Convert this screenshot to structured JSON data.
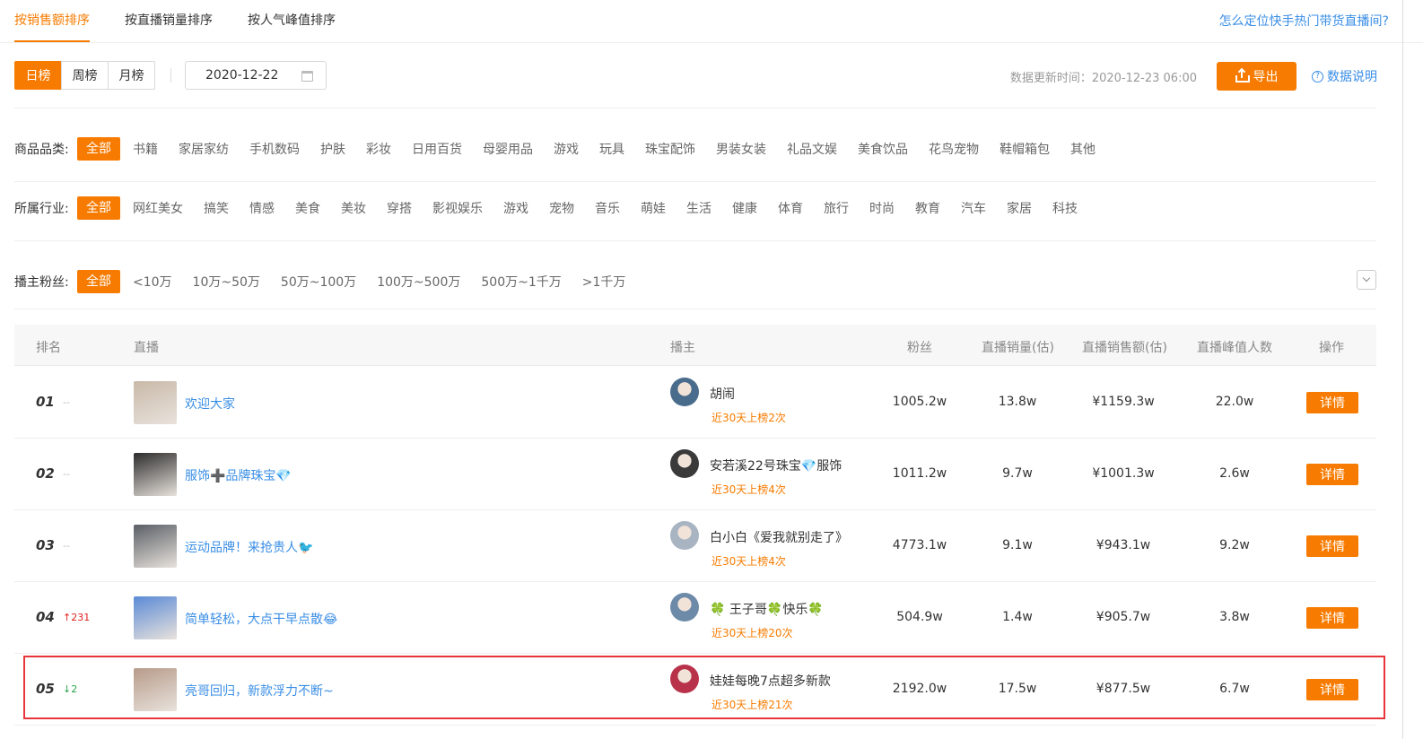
{
  "tabs": [
    {
      "label": "按销售额排序",
      "active": true
    },
    {
      "label": "按直播销量排序",
      "active": false
    },
    {
      "label": "按人气峰值排序",
      "active": false
    }
  ],
  "help_link": "怎么定位快手热门带货直播间?",
  "periods": [
    {
      "label": "日榜",
      "active": true
    },
    {
      "label": "周榜",
      "active": false
    },
    {
      "label": "月榜",
      "active": false
    }
  ],
  "date_value": "2020-12-22",
  "update_time": "数据更新时间：2020-12-23 06:00",
  "export_label": "导出",
  "data_desc_label": "数据说明",
  "filters": {
    "category": {
      "label": "商品品类:",
      "options": [
        "全部",
        "书籍",
        "家居家纺",
        "手机数码",
        "护肤",
        "彩妆",
        "日用百货",
        "母婴用品",
        "游戏",
        "玩具",
        "珠宝配饰",
        "男装女装",
        "礼品文娱",
        "美食饮品",
        "花鸟宠物",
        "鞋帽箱包",
        "其他"
      ]
    },
    "industry": {
      "label": "所属行业:",
      "options": [
        "全部",
        "网红美女",
        "搞笑",
        "情感",
        "美食",
        "美妆",
        "穿搭",
        "影视娱乐",
        "游戏",
        "宠物",
        "音乐",
        "萌娃",
        "生活",
        "健康",
        "体育",
        "旅行",
        "时尚",
        "教育",
        "汽车",
        "家居",
        "科技"
      ]
    },
    "fans": {
      "label": "播主粉丝:",
      "options": [
        "全部",
        "<10万",
        "10万~50万",
        "50万~100万",
        "100万~500万",
        "500万~1千万",
        ">1千万"
      ]
    }
  },
  "table": {
    "headers": {
      "rank": "排名",
      "live": "直播",
      "anchor": "播主",
      "fans": "粉丝",
      "sales_volume": "直播销量(估)",
      "sales_amount": "直播销售额(估)",
      "peak": "直播峰值人数",
      "action": "操作"
    },
    "rows": [
      {
        "rank": "01",
        "trend": "--",
        "trend_type": "flat",
        "title": "欢迎大家",
        "anchor": "胡闹",
        "badge": "近30天上榜2次",
        "fans": "1005.2w",
        "volume": "13.8w",
        "amount": "¥1159.3w",
        "peak": "22.0w",
        "action": "详情",
        "thumb_color": "#c9b9a8",
        "avatar_color": "#4a6c8c"
      },
      {
        "rank": "02",
        "trend": "--",
        "trend_type": "flat",
        "title": "服饰➕品牌珠宝💎",
        "anchor": "安若溪22号珠宝💎服饰",
        "badge": "近30天上榜4次",
        "fans": "1011.2w",
        "volume": "9.7w",
        "amount": "¥1001.3w",
        "peak": "2.6w",
        "action": "详情",
        "thumb_color": "#2c2c2c",
        "avatar_color": "#3a3a3a"
      },
      {
        "rank": "03",
        "trend": "--",
        "trend_type": "flat",
        "title": "运动品牌！来抢贵人🐦",
        "anchor": "白小白《爱我就别走了》",
        "badge": "近30天上榜4次",
        "fans": "4773.1w",
        "volume": "9.1w",
        "amount": "¥943.1w",
        "peak": "9.2w",
        "action": "详情",
        "thumb_color": "#5a5f66",
        "avatar_color": "#a9b4c2"
      },
      {
        "rank": "04",
        "trend": "↑231",
        "trend_type": "up",
        "title": "简单轻松，大点干早点散😂",
        "anchor": "🍀 王子哥🍀快乐🍀",
        "badge": "近30天上榜20次",
        "fans": "504.9w",
        "volume": "1.4w",
        "amount": "¥905.7w",
        "peak": "3.8w",
        "action": "详情",
        "thumb_color": "#5b8ad6",
        "avatar_color": "#6d8aa8"
      },
      {
        "rank": "05",
        "trend": "↓2",
        "trend_type": "down",
        "title": "亮哥回归，新款浮力不断~",
        "anchor": "娃娃每晚7点超多新款",
        "badge": "近30天上榜21次",
        "fans": "2192.0w",
        "volume": "17.5w",
        "amount": "¥877.5w",
        "peak": "6.7w",
        "action": "详情",
        "thumb_color": "#b79b8a",
        "avatar_color": "#b8334a"
      }
    ]
  }
}
